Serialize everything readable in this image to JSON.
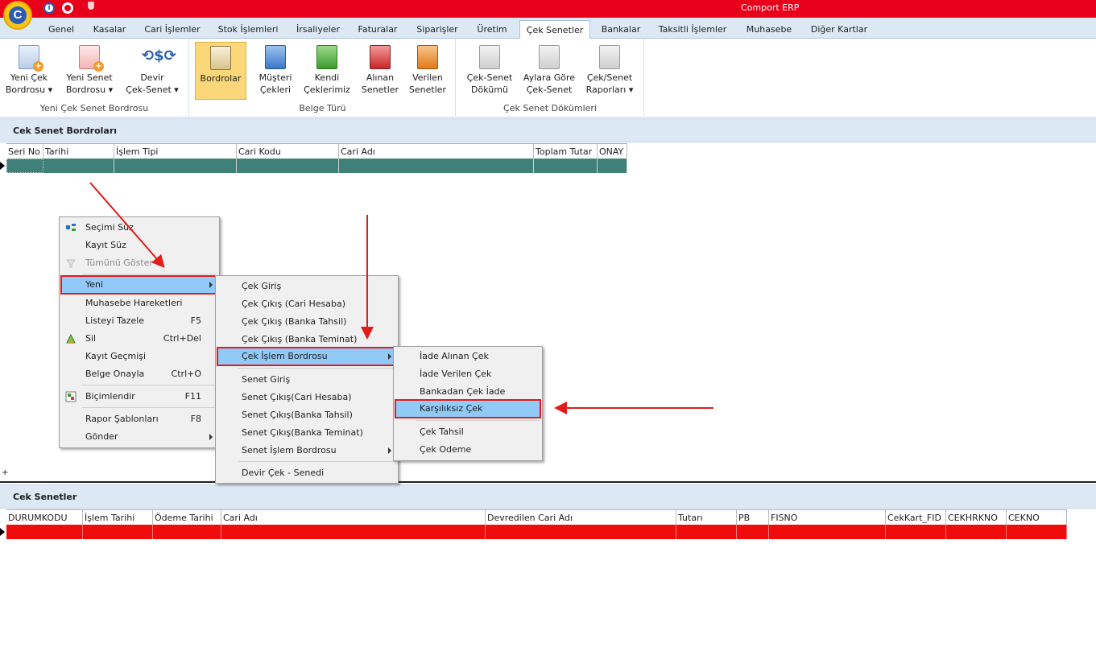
{
  "app": {
    "title": "Comport ERP",
    "logo_letter": "C"
  },
  "tabs": [
    "Genel",
    "Kasalar",
    "Cari İşlemler",
    "Stok İşlemleri",
    "İrsaliyeler",
    "Faturalar",
    "Siparişler",
    "Üretim",
    "Çek Senetler",
    "Bankalar",
    "Taksitli İşlemler",
    "Muhasebe",
    "Diğer Kartlar"
  ],
  "active_tab": "Çek Senetler",
  "ribbon": {
    "groups": [
      {
        "caption": "Yeni Çek Senet Bordrosu",
        "buttons": [
          {
            "line1": "Yeni Çek",
            "line2": "Bordrosu ▾",
            "icon": "new-check-icon"
          },
          {
            "line1": "Yeni Senet",
            "line2": "Bordrosu ▾",
            "icon": "new-note-icon"
          },
          {
            "line1": "Devir",
            "line2": "Çek-Senet ▾",
            "icon": "transfer-dollar-icon"
          }
        ]
      },
      {
        "caption": "Belge Türü",
        "buttons": [
          {
            "line1": "Bordrolar",
            "line2": "",
            "icon": "pencil-paper-icon",
            "active": true
          },
          {
            "line1": "Müşteri",
            "line2": "Çekleri",
            "icon": "customer-checks-icon"
          },
          {
            "line1": "Kendi",
            "line2": "Çeklerimiz",
            "icon": "own-checks-icon"
          },
          {
            "line1": "Alınan",
            "line2": "Senetler",
            "icon": "received-notes-icon"
          },
          {
            "line1": "Verilen",
            "line2": "Senetler",
            "icon": "given-notes-icon"
          }
        ]
      },
      {
        "caption": "Çek Senet Dökümleri",
        "buttons": [
          {
            "line1": "Çek-Senet",
            "line2": "Dökümü",
            "icon": "report-doc-icon"
          },
          {
            "line1": "Aylara Göre",
            "line2": "Çek-Senet",
            "icon": "monthly-doc-icon"
          },
          {
            "line1": "Çek/Senet",
            "line2": "Raporları ▾",
            "icon": "reports-icon"
          }
        ]
      }
    ]
  },
  "bordro_section": {
    "title": "Cek Senet Bordroları",
    "columns": [
      "Seri No",
      "Tarihi",
      "İşlem Tipi",
      "Cari Kodu",
      "Cari Adı",
      "Toplam Tutar",
      "ONAY"
    ],
    "row_color": "#3f8178"
  },
  "senet_section": {
    "title": "Cek Senetler",
    "columns": [
      "DURUMKODU",
      "İşlem Tarihi",
      "Ödeme Tarihi",
      "Cari Adı",
      "Devredilen Cari Adı",
      "Tutarı",
      "PB",
      "FISNO",
      "CekKart_FID",
      "CEKHRKNO",
      "CEKNO"
    ],
    "row_color": "#ee0c0c"
  },
  "footer_marker": "+",
  "context_menu": {
    "items": [
      {
        "label": "Seçimi Süz",
        "shortcut": "",
        "icon": "filter-icon"
      },
      {
        "label": "Kayıt Süz",
        "shortcut": ""
      },
      {
        "label": "Tümünü Göster",
        "shortcut": "",
        "disabled": true,
        "icon": "clear-filter-icon"
      },
      {
        "label": "Yeni",
        "shortcut": "",
        "submenu": true,
        "highlighted": true
      },
      {
        "label": "Muhasebe Hareketleri",
        "shortcut": ""
      },
      {
        "label": "Listeyi Tazele",
        "shortcut": "F5"
      },
      {
        "label": "Sil",
        "shortcut": "Ctrl+Del",
        "icon": "delete-icon"
      },
      {
        "label": "Kayıt Geçmişi",
        "shortcut": ""
      },
      {
        "label": "Belge Onayla",
        "shortcut": "Ctrl+O"
      },
      {
        "label": "Biçimlendir",
        "shortcut": "F11",
        "icon": "format-icon"
      },
      {
        "label": "Rapor Şablonları",
        "shortcut": "F8"
      },
      {
        "label": "Gönder",
        "shortcut": "",
        "submenu": true
      }
    ]
  },
  "submenu_yeni": {
    "items": [
      {
        "label": "Çek Giriş"
      },
      {
        "label": "Çek Çıkış (Cari Hesaba)"
      },
      {
        "label": "Çek Çıkış (Banka Tahsil)"
      },
      {
        "label": "Çek Çıkış (Banka Teminat)"
      },
      {
        "label": "Çek İşlem Bordrosu",
        "submenu": true,
        "highlighted": true
      },
      {
        "label": "Senet Giriş"
      },
      {
        "label": "Senet Çıkış(Cari Hesaba)"
      },
      {
        "label": "Senet Çıkış(Banka Tahsil)"
      },
      {
        "label": "Senet Çıkış(Banka Teminat)"
      },
      {
        "label": "Senet İşlem Bordrosu",
        "submenu": true
      },
      {
        "label": "Devir Çek - Senedi"
      }
    ]
  },
  "submenu_cek_islem": {
    "items": [
      {
        "label": "İade Alınan Çek"
      },
      {
        "label": "İade Verilen Çek"
      },
      {
        "label": "Bankadan Çek İade"
      },
      {
        "label": "Karşılıksız Çek",
        "highlighted": true
      },
      {
        "label": "Çek Tahsil"
      },
      {
        "label": "Çek Odeme"
      }
    ]
  },
  "colors": {
    "titlebar": "#e8001a",
    "highlight": "#91c9f7",
    "annotation": "#e21b1b"
  }
}
